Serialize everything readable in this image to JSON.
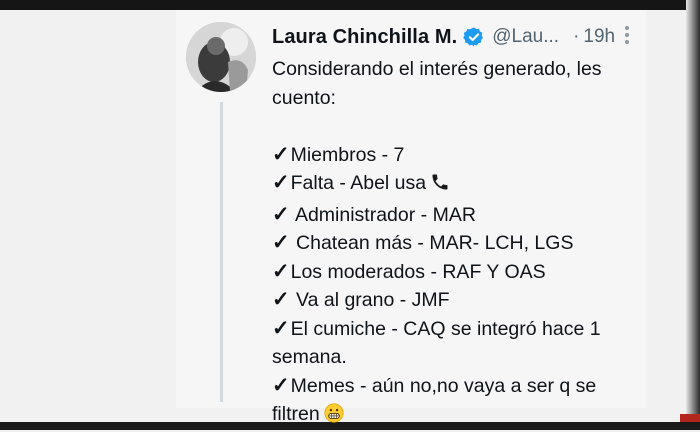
{
  "tweet": {
    "author_name": "Laura Chinchilla M.",
    "handle": "@Lau...",
    "separator": "·",
    "time": "19h",
    "intro_line1": "Considerando el interés generado, les",
    "intro_line2": "cuento:",
    "check_mark": "✓",
    "items": [
      {
        "text": "Miembros - 7"
      },
      {
        "text": "Falta - Abel usa",
        "icon": "phone-icon"
      },
      {
        "text": " Administrador - MAR"
      },
      {
        "text": " Chatean más - MAR- LCH, LGS"
      },
      {
        "text": "Los moderados - RAF Y OAS"
      },
      {
        "text": " Va al grano - JMF"
      },
      {
        "text": "El cumiche - CAQ se integró hace 1",
        "continuation": "semana."
      },
      {
        "text": "Memes - aún no,no vaya a ser q se",
        "continuation": "filtren",
        "icon": "grimacing-emoji-icon"
      }
    ]
  },
  "colors": {
    "verified_blue": "#1d9bf0",
    "secondary_text": "#536471",
    "thread_line": "#cfd9de"
  }
}
